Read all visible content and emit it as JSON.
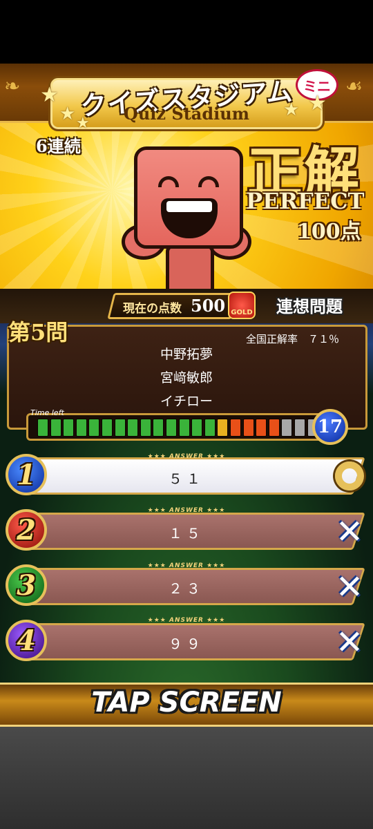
{
  "header": {
    "title_jp": "クイズスタジアム",
    "title_en": "Quiz Stadium",
    "mini_badge": "ミニ"
  },
  "result": {
    "streak": "6連続",
    "verdict": "正解",
    "perfect": "PERFECT",
    "points": "100点"
  },
  "score": {
    "label": "現在の点数",
    "value": "500",
    "gold_label": "GOLD"
  },
  "category": "連想問題",
  "question": {
    "number": "第5問",
    "correct_rate": "全国正解率　７１％",
    "clues": [
      "中野拓夢",
      "宮﨑敏郎",
      "イチロー"
    ]
  },
  "timer": {
    "label": "Time left",
    "seconds": "17",
    "segment_colors": [
      "#3ab33a",
      "#3ab33a",
      "#3ab33a",
      "#3ab33a",
      "#3ab33a",
      "#3ab33a",
      "#3ab33a",
      "#3ab33a",
      "#3ab33a",
      "#3ab33a",
      "#3ab33a",
      "#3ab33a",
      "#3ab33a",
      "#3ab33a",
      "#e8b020",
      "#e85018",
      "#e85018",
      "#e85018",
      "#e85018",
      "#a8a8a8",
      "#a8a8a8",
      "#a8a8a8"
    ]
  },
  "answers": [
    {
      "number": "1",
      "tag": "★★★ ANSWER ★★★",
      "text": "５１",
      "correct": true,
      "badge_color": "#1e4fc8"
    },
    {
      "number": "2",
      "tag": "★★★ ANSWER ★★★",
      "text": "１５",
      "correct": false,
      "badge_color": "#c8281e"
    },
    {
      "number": "3",
      "tag": "★★★ ANSWER ★★★",
      "text": "２３",
      "correct": false,
      "badge_color": "#1e8a2e"
    },
    {
      "number": "4",
      "tag": "★★★ ANSWER ★★★",
      "text": "９９",
      "correct": false,
      "badge_color": "#6a2ab0"
    }
  ],
  "footer": {
    "tap_label": "TAP SCREEN"
  },
  "colors": {
    "gold": "#e6c05a",
    "banner": "#ffd21a",
    "panel": "#3e2214"
  }
}
